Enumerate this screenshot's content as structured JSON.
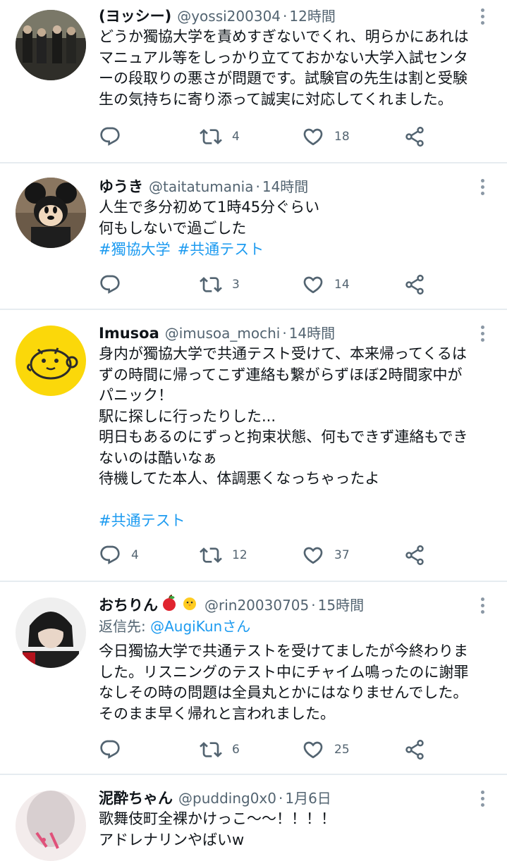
{
  "tweets": [
    {
      "name": "(ヨッシー)",
      "handle": "@yossi200304",
      "time": "12時間",
      "text": "どうか獨協大学を責めすぎないでくれ、明らかにあれは\nマニュアル等をしっかり立てておかない大学入試センタ\nーの段取りの悪さが問題です。試験官の先生は割と受験\n生の気持ちに寄り添って誠実に対応してくれました。",
      "replies": "",
      "retweets": "4",
      "likes": "18"
    },
    {
      "name": "ゆうき",
      "handle": "@taitatumania",
      "time": "14時間",
      "text": "人生で多分初めて1時45分ぐらい\n何もしないで過ごした",
      "tags": [
        "#獨協大学",
        "#共通テスト"
      ],
      "replies": "",
      "retweets": "3",
      "likes": "14"
    },
    {
      "name": "Imusoa",
      "handle": "@imusoa_mochi",
      "time": "14時間",
      "text": "身内が獨協大学で共通テスト受けて、本来帰ってくるは\nずの時間に帰ってこず連絡も繋がらずほぼ2時間家中が\nパニック！\n駅に探しに行ったりした...\n明日もあるのにずっと拘束状態、何もできず連絡もでき\nないのは酷いなぁ\n待機してた本人、体調悪くなっちゃったよ",
      "tags": [
        "#共通テスト"
      ],
      "replies": "4",
      "retweets": "12",
      "likes": "37"
    },
    {
      "name": "おちりん",
      "name_emojis": [
        "apple-emoji",
        "chick-emoji"
      ],
      "handle": "@rin20030705",
      "time": "15時間",
      "reply_prefix": "返信先: ",
      "reply_to": "@AugiKunさん",
      "text": "今日獨協大学で共通テストを受けてましたが今終わりま\nした。リスニングのテスト中にチャイム鳴ったのに謝罪\nなしその時の問題は全員丸とかにはなりませんでした。\nそのまま早く帰れと言われました。",
      "replies": "",
      "retweets": "6",
      "likes": "25"
    },
    {
      "name": "泥酔ちゃん",
      "handle": "@pudding0x0",
      "time": "1月6日",
      "text": "歌舞伎町全裸かけっこ〜〜！！！！\nアドレナリンやばいw"
    }
  ],
  "separator": "·",
  "icons": {
    "reply": "reply-icon",
    "retweet": "retweet-icon",
    "like": "like-icon",
    "share": "share-icon",
    "more": "more-icon"
  },
  "colors": {
    "text": "#0f1419",
    "secondary": "#536471",
    "link": "#1d9bf0",
    "divider": "#e6ecf0"
  }
}
